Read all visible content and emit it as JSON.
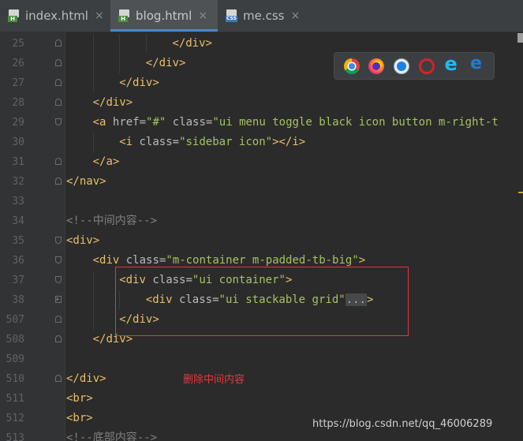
{
  "tabs": [
    {
      "label": "index.html",
      "icon": "html-file-icon",
      "badge": "H",
      "type": "html",
      "close": "×",
      "active": false
    },
    {
      "label": "blog.html",
      "icon": "html-file-icon",
      "badge": "H",
      "type": "html",
      "close": "×",
      "active": true
    },
    {
      "label": "me.css",
      "icon": "css-file-icon",
      "badge": "CSS",
      "type": "css",
      "close": "×",
      "active": false
    }
  ],
  "browsers": [
    "chrome-icon",
    "firefox-icon",
    "safari-icon",
    "opera-icon",
    "ie-icon",
    "edge-icon"
  ],
  "lines": [
    {
      "n": "25",
      "fold": "close",
      "indent": 16,
      "tokens": [
        [
          "tag",
          "</div>"
        ]
      ]
    },
    {
      "n": "26",
      "fold": "close",
      "indent": 12,
      "tokens": [
        [
          "tag",
          "</div>"
        ]
      ]
    },
    {
      "n": "27",
      "fold": "close",
      "indent": 8,
      "tokens": [
        [
          "tag",
          "</div>"
        ]
      ]
    },
    {
      "n": "28",
      "fold": "close",
      "indent": 4,
      "tokens": [
        [
          "tag",
          "</div>"
        ]
      ]
    },
    {
      "n": "29",
      "fold": "open",
      "indent": 4,
      "tokens": [
        [
          "tag",
          "<a "
        ],
        [
          "attr",
          "href="
        ],
        [
          "val",
          "\"#\""
        ],
        [
          "attr",
          " class="
        ],
        [
          "val",
          "\"ui menu toggle black icon button m-right-t"
        ]
      ]
    },
    {
      "n": "30",
      "fold": "",
      "indent": 8,
      "tokens": [
        [
          "tag",
          "<i "
        ],
        [
          "attr",
          "class="
        ],
        [
          "val",
          "\"sidebar icon\""
        ],
        [
          "tag",
          "></i>"
        ]
      ]
    },
    {
      "n": "31",
      "fold": "close",
      "indent": 4,
      "tokens": [
        [
          "tag",
          "</a>"
        ]
      ]
    },
    {
      "n": "32",
      "fold": "close",
      "indent": 0,
      "tokens": [
        [
          "tag",
          "</nav>"
        ]
      ]
    },
    {
      "n": "33",
      "fold": "",
      "indent": 0,
      "tokens": []
    },
    {
      "n": "34",
      "fold": "",
      "indent": 0,
      "tokens": [
        [
          "cmt",
          "<!--中间内容-->"
        ]
      ]
    },
    {
      "n": "35",
      "fold": "open",
      "indent": 0,
      "tokens": [
        [
          "tag",
          "<div>"
        ]
      ]
    },
    {
      "n": "36",
      "fold": "open",
      "indent": 4,
      "tokens": [
        [
          "tag",
          "<div "
        ],
        [
          "attr",
          "class="
        ],
        [
          "val",
          "\"m-container m-padded-tb-big\""
        ],
        [
          "tag",
          ">"
        ]
      ]
    },
    {
      "n": "37",
      "fold": "open",
      "indent": 8,
      "tokens": [
        [
          "tag",
          "<div "
        ],
        [
          "attr",
          "class="
        ],
        [
          "val",
          "\"ui container\""
        ],
        [
          "tag",
          ">"
        ]
      ]
    },
    {
      "n": "38",
      "fold": "plus",
      "indent": 12,
      "tokens": [
        [
          "tag",
          "<div "
        ],
        [
          "attr",
          "class="
        ],
        [
          "val",
          "\"ui stackable grid\""
        ],
        [
          "ell",
          "..."
        ],
        [
          "tag",
          ">"
        ]
      ]
    },
    {
      "n": "507",
      "fold": "close",
      "indent": 8,
      "tokens": [
        [
          "tag",
          "</div>"
        ]
      ]
    },
    {
      "n": "508",
      "fold": "close",
      "indent": 4,
      "tokens": [
        [
          "tag",
          "</div>"
        ]
      ]
    },
    {
      "n": "509",
      "fold": "",
      "indent": 0,
      "tokens": []
    },
    {
      "n": "510",
      "fold": "close",
      "indent": 0,
      "tokens": [
        [
          "tag",
          "</div>"
        ]
      ]
    },
    {
      "n": "511",
      "fold": "",
      "indent": 0,
      "tokens": [
        [
          "tag",
          "<br>"
        ]
      ]
    },
    {
      "n": "512",
      "fold": "",
      "indent": 0,
      "tokens": [
        [
          "tag",
          "<br>"
        ]
      ]
    },
    {
      "n": "513",
      "fold": "",
      "indent": 0,
      "tokens": [
        [
          "cmt",
          "<!--底部内容-->"
        ]
      ]
    }
  ],
  "annotation": "删除中间内容",
  "watermark": "https://blog.csdn.net/qq_46006289",
  "colors": {
    "tag": "#e8bf6a",
    "attr": "#bababa",
    "val": "#a5c261",
    "cmt": "#808080",
    "highlight": "#e8363b",
    "active_tab": "#4a88c7"
  }
}
